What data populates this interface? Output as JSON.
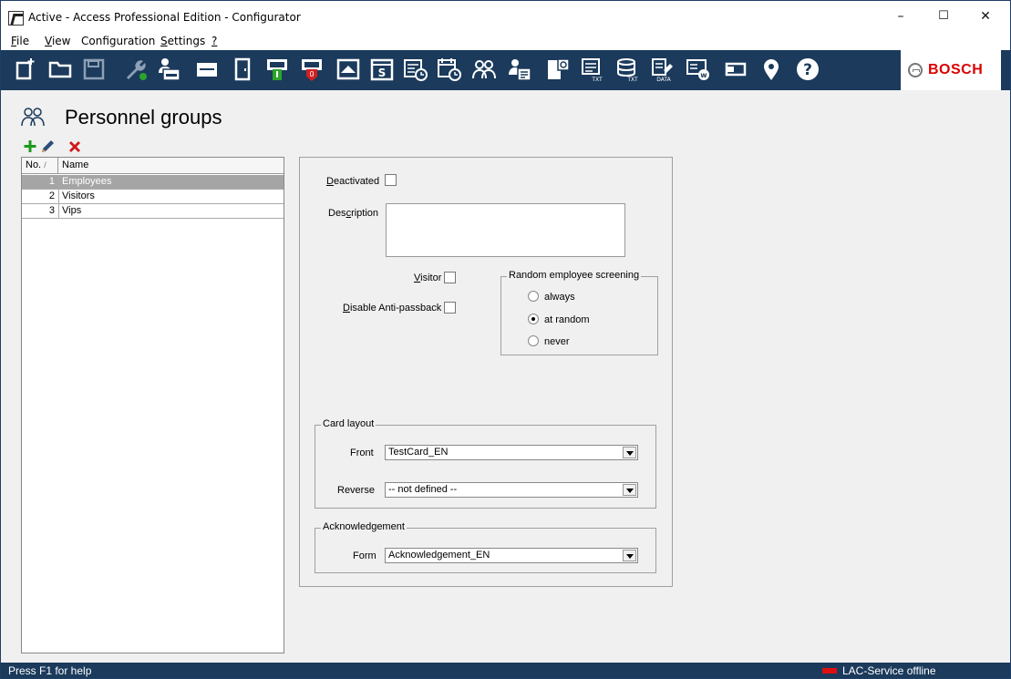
{
  "window": {
    "title": "Active - Access Professional Edition - Configurator",
    "minimize": "–",
    "maximize": "☐",
    "close": "✕"
  },
  "menu": {
    "file_u": "F",
    "file_rest": "ile",
    "view_u": "V",
    "view_rest": "iew",
    "configuration": "Configuration",
    "settings_u": "S",
    "settings_rest": "ettings",
    "help": "?"
  },
  "toolbar": {
    "icons": [
      "new-icon",
      "open-folder-icon",
      "save-icon",
      "wrench-icon",
      "person-card-icon",
      "card-reader-icon",
      "door-icon",
      "entry-display-icon",
      "exit-display-icon",
      "area-icon",
      "schedule-icon",
      "time-model-icon",
      "calendar-time-icon",
      "personnel-groups-icon",
      "person-card-id-icon",
      "door-model-icon",
      "report-text-icon",
      "database-text-icon",
      "database-data-icon",
      "card-print-icon",
      "reader-icon",
      "location-icon",
      "help-icon"
    ],
    "brand": "BOSCH",
    "brand_color": "#d00000",
    "bg_color": "#1b3a5c"
  },
  "page": {
    "title": "Personnel groups"
  },
  "list": {
    "col_no": "No.",
    "col_sort": "/",
    "col_name": "Name",
    "rows": [
      {
        "no": "1",
        "name": "Employees"
      },
      {
        "no": "2",
        "name": "Visitors"
      },
      {
        "no": "3",
        "name": "Vips"
      }
    ]
  },
  "details": {
    "deactivated_u": "D",
    "deactivated_rest": "eactivated",
    "description_pre": "Des",
    "description_u": "c",
    "description_rest": "ription",
    "description_value": "",
    "visitor_u": "V",
    "visitor_rest": "isitor",
    "disable_u": "D",
    "disable_rest": "isable Anti-passback",
    "random_group_title": "Random employee screening",
    "random_options": [
      "always",
      "at random",
      "never"
    ],
    "random_selected": "at random",
    "card_layout_title": "Card layout",
    "front_label": "Front",
    "front_value": "TestCard_EN",
    "reverse_label": "Reverse",
    "reverse_value": "-- not defined --",
    "ack_title": "Acknowledgement",
    "form_label": "Form",
    "form_value": "Acknowledgement_EN"
  },
  "status": {
    "help": "Press F1 for help",
    "service": "LAC-Service offline",
    "service_color": "#e01010"
  }
}
